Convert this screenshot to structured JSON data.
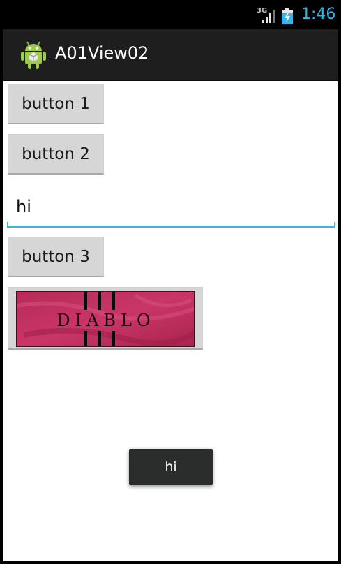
{
  "status_bar": {
    "network_type": "3G",
    "signal_icon": "signal-bars-icon",
    "battery_icon": "battery-charging-icon",
    "time": "1:46",
    "time_color": "#33b5e5"
  },
  "action_bar": {
    "app_icon": "android-robot-icon",
    "title": "A01View02"
  },
  "content": {
    "button_1_label": "button 1",
    "button_2_label": "button 2",
    "edit_text_value": "hi",
    "button_3_label": "button 3",
    "image_button": {
      "image_text": "DIABLO"
    }
  },
  "toast": {
    "message": "hi"
  },
  "colors": {
    "accent": "#33b5e5",
    "action_bar_bg": "#1e1e1e",
    "button_bg": "#d6d6d6",
    "toast_bg": "#2b2d2c",
    "diablo_bg": "#c0305f"
  }
}
